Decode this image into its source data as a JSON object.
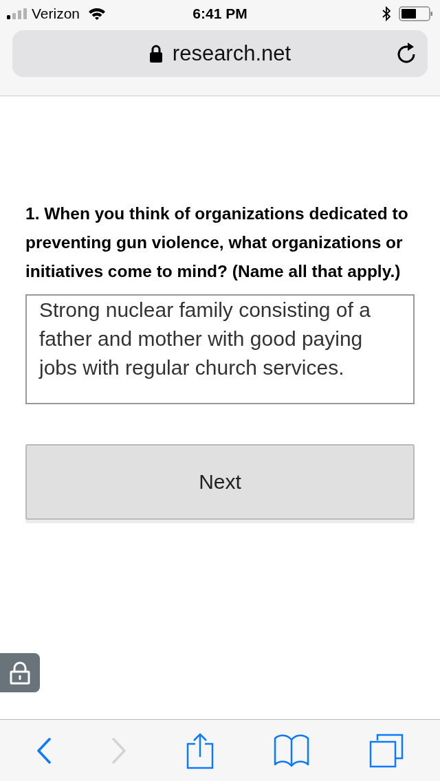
{
  "status_bar": {
    "carrier": "Verizon",
    "time": "6:41 PM"
  },
  "address_bar": {
    "url": "research.net",
    "secure": true
  },
  "question": {
    "text": "1. When you think of organizations dedicated to preventing gun violence, what organizations or initiatives come to mind? (Name all that apply.)",
    "answer": "Strong nuclear family consisting of a father and mother with good paying jobs with regular church services."
  },
  "next_button": {
    "label": "Next"
  },
  "toolbar": {
    "items": [
      {
        "kind": "back",
        "disabled": false
      },
      {
        "kind": "forward",
        "disabled": true
      },
      {
        "kind": "share",
        "disabled": false
      },
      {
        "kind": "bookmarks",
        "disabled": false
      },
      {
        "kind": "tabs",
        "disabled": false
      }
    ]
  }
}
